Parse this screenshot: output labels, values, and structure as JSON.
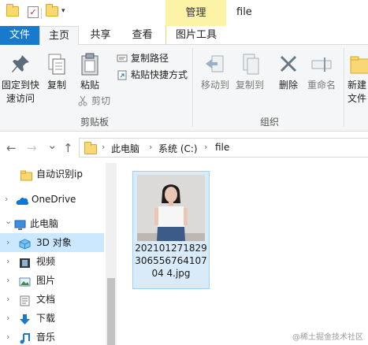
{
  "titlebar": {
    "manage_label": "管理",
    "window_title": "file",
    "dropdown_glyph": "▾"
  },
  "tabs": {
    "file": "文件",
    "home": "主页",
    "share": "共享",
    "view": "查看",
    "picture_tools": "图片工具"
  },
  "ribbon": {
    "pin_quick_access": [
      "固定到快",
      "速访问"
    ],
    "copy": "复制",
    "paste": "粘贴",
    "copy_path": "复制路径",
    "paste_shortcut": "粘贴快捷方式",
    "cut": "剪切",
    "clipboard_group": "剪贴板",
    "move_to": "移动到",
    "copy_to": "复制到",
    "delete": "删除",
    "rename": "重命名",
    "organize_group": "组织",
    "new_folder": [
      "新建",
      "文件"
    ]
  },
  "address": {
    "back": "←",
    "forward": "→",
    "recent": "⌄",
    "up": "↑",
    "crumbs": [
      "此电脑",
      "系统 (C:)",
      "file"
    ],
    "separator": "›"
  },
  "nav": {
    "items": [
      {
        "label": "自动识别ip",
        "icon": "folder-icon",
        "chevron": ""
      },
      {
        "label": "OneDrive",
        "icon": "cloud-icon",
        "chevron": "›"
      },
      {
        "label": "此电脑",
        "icon": "computer-icon",
        "chevron": "⌄"
      },
      {
        "label": "3D 对象",
        "icon": "cube-3d-icon",
        "chevron": "›"
      },
      {
        "label": "视频",
        "icon": "video-icon",
        "chevron": "›"
      },
      {
        "label": "图片",
        "icon": "picture-icon",
        "chevron": "›"
      },
      {
        "label": "文档",
        "icon": "document-icon",
        "chevron": "›"
      },
      {
        "label": "下载",
        "icon": "download-icon",
        "chevron": "›"
      },
      {
        "label": "音乐",
        "icon": "music-icon",
        "chevron": "›"
      }
    ]
  },
  "content": {
    "file_name": "20210127182930655676410704 4.jpg"
  },
  "watermark": "@稀土掘金技术社区",
  "colors": {
    "accent": "#1979ca",
    "manage_tab": "#fcf3a7",
    "selected": "#cce8ff",
    "tile_selected": "#d9ebf9"
  }
}
